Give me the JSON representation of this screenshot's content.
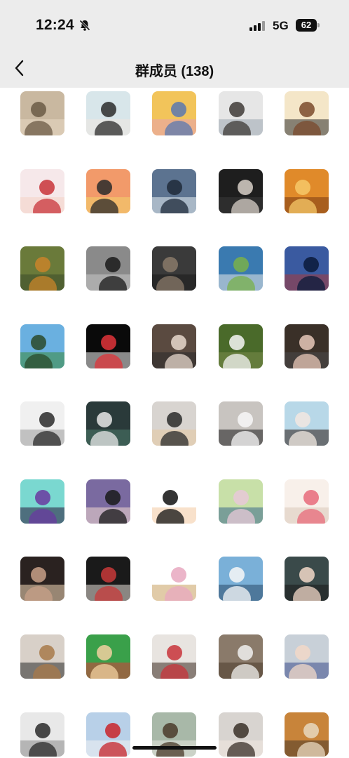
{
  "status_bar": {
    "time": "12:24",
    "network": "5G",
    "battery": "62"
  },
  "nav": {
    "title": "群成员 (138)"
  },
  "members": [
    {
      "colors": [
        "#c9b8a0",
        "#6b5a45",
        "#e8d9c4"
      ]
    },
    {
      "colors": [
        "#d8e6ea",
        "#2b2b2b",
        "#f1e6df"
      ]
    },
    {
      "colors": [
        "#f2c45a",
        "#5a78b0",
        "#e8a0b4"
      ]
    },
    {
      "colors": [
        "#e6e6e6",
        "#3e3a36",
        "#9aa6b0"
      ]
    },
    {
      "colors": [
        "#f4e6c8",
        "#7a4a2c",
        "#2e2e2e"
      ]
    },
    {
      "colors": [
        "#f6e8ea",
        "#c8343a",
        "#f4d2c4"
      ]
    },
    {
      "colors": [
        "#f29a6a",
        "#2a2a2a",
        "#f2d46a"
      ]
    },
    {
      "colors": [
        "#5c7390",
        "#1e2a3a",
        "#e8eef2"
      ]
    },
    {
      "colors": [
        "#1e1e1e",
        "#d8d0c8",
        "#3a3a3a"
      ]
    },
    {
      "colors": [
        "#e08a2a",
        "#f6c868",
        "#7a3a12"
      ]
    },
    {
      "colors": [
        "#6a7a3a",
        "#c8842a",
        "#3a4a2a"
      ]
    },
    {
      "colors": [
        "#8a8a8a",
        "#1a1a1a",
        "#c8c8c8"
      ]
    },
    {
      "colors": [
        "#3a3a3a",
        "#8a7a6a",
        "#1a1a1a"
      ]
    },
    {
      "colors": [
        "#3a7ab0",
        "#7ab04a",
        "#e8e8e8"
      ]
    },
    {
      "colors": [
        "#3a5aa0",
        "#0a1a3a",
        "#a83a3a"
      ]
    },
    {
      "colors": [
        "#6ab0e0",
        "#2a4a2a",
        "#3a8a3a"
      ]
    },
    {
      "colors": [
        "#0a0a0a",
        "#e0343a",
        "#f2f2f2"
      ]
    },
    {
      "colors": [
        "#5a4a40",
        "#e8d8cc",
        "#2a2a2a"
      ]
    },
    {
      "colors": [
        "#4a6a2a",
        "#f6f6f6",
        "#7a8a4a"
      ]
    },
    {
      "colors": [
        "#3a3028",
        "#e8c8b8",
        "#4a4a4a"
      ]
    },
    {
      "colors": [
        "#f0f0f0",
        "#2a2a2a",
        "#9a9a9a"
      ]
    },
    {
      "colors": [
        "#2a3a3a",
        "#e8e8e8",
        "#4a7a6a"
      ]
    },
    {
      "colors": [
        "#d8d4d0",
        "#2a2a2a",
        "#e8c8a0"
      ]
    },
    {
      "colors": [
        "#c8c4c0",
        "#f8f8f8",
        "#1a1a1a"
      ]
    },
    {
      "colors": [
        "#b8d8e8",
        "#f2e8e0",
        "#2a1a12"
      ]
    },
    {
      "colors": [
        "#7ad8d0",
        "#6a3aa0",
        "#2a1a3a"
      ]
    },
    {
      "colors": [
        "#7a6aa0",
        "#1a1a1a",
        "#f2d8d0"
      ]
    },
    {
      "colors": [
        "#ffffff",
        "#111111",
        "#f2c8a0"
      ]
    },
    {
      "colors": [
        "#c8e0a8",
        "#e8c8d8",
        "#3a6a8a"
      ]
    },
    {
      "colors": [
        "#f8f0ea",
        "#e86a7a",
        "#d8c8b8"
      ]
    },
    {
      "colors": [
        "#2a2220",
        "#c8a088",
        "#f2d8b8"
      ]
    },
    {
      "colors": [
        "#1a1a1a",
        "#c83a3a",
        "#e8e0d8"
      ]
    },
    {
      "colors": [
        "#ffffff",
        "#e8a8c0",
        "#c8a060"
      ]
    },
    {
      "colors": [
        "#7ab0d8",
        "#f8f8f8",
        "#2a4a6a"
      ]
    },
    {
      "colors": [
        "#3a4a4a",
        "#f2d8c8",
        "#1a1a1a"
      ]
    },
    {
      "colors": [
        "#d8d0c8",
        "#a87a4a",
        "#2a2a2a"
      ]
    },
    {
      "colors": [
        "#3aa04a",
        "#f2d0a0",
        "#d83a3a"
      ]
    },
    {
      "colors": [
        "#e8e4e0",
        "#c8343a",
        "#3a2a20"
      ]
    },
    {
      "colors": [
        "#8a7a6a",
        "#f0f0ee",
        "#4a3a2a"
      ]
    },
    {
      "colors": [
        "#c8d0d8",
        "#f2d8c8",
        "#3a4a8a"
      ]
    },
    {
      "colors": [
        "#e8e8e8",
        "#2a2a2a",
        "#8a8a8a"
      ]
    },
    {
      "colors": [
        "#b8d0e8",
        "#c8242a",
        "#f2f2f2"
      ]
    },
    {
      "colors": [
        "#a8b8a8",
        "#4a3a2a",
        "#e8e8e0"
      ]
    },
    {
      "colors": [
        "#d8d4d0",
        "#3a3028",
        "#f2e8e0"
      ]
    },
    {
      "colors": [
        "#c8843a",
        "#e8d8c0",
        "#4a3a2a"
      ]
    }
  ]
}
